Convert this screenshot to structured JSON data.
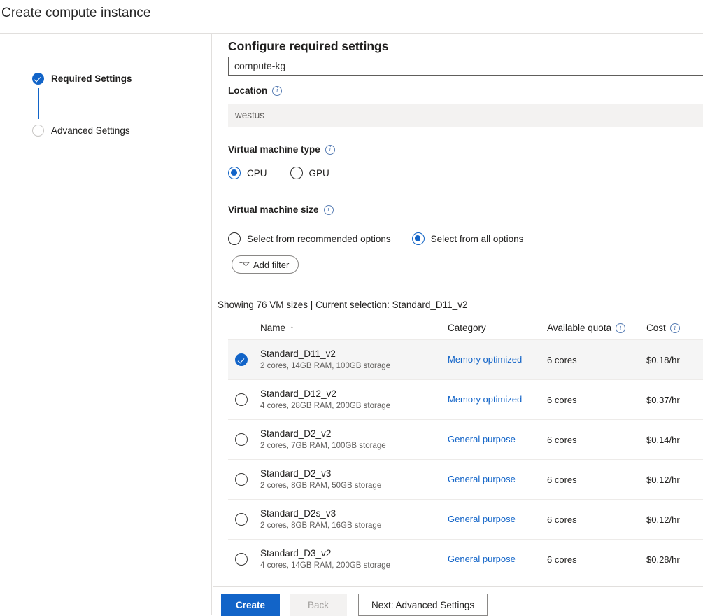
{
  "window": {
    "title": "Create compute instance"
  },
  "wizard": {
    "steps": [
      {
        "label": "Required Settings",
        "state": "done"
      },
      {
        "label": "Advanced Settings",
        "state": "todo"
      }
    ]
  },
  "panel": {
    "heading": "Configure required settings",
    "clipped_field_value": "compute-kg",
    "location": {
      "label": "Location",
      "info_icon": "info-icon",
      "value": "westus"
    },
    "vm_type": {
      "label": "Virtual machine type",
      "info_icon": "info-icon",
      "options": [
        {
          "label": "CPU",
          "selected": true
        },
        {
          "label": "GPU",
          "selected": false
        }
      ]
    },
    "vm_size": {
      "label": "Virtual machine size",
      "info_icon": "info-icon",
      "options": [
        {
          "label": "Select from recommended options",
          "selected": false
        },
        {
          "label": "Select from all options",
          "selected": true
        }
      ],
      "add_filter_label": "Add filter",
      "add_filter_icon": "filter-funnel-icon"
    },
    "showing_text": "Showing 76 VM sizes | Current selection: Standard_D11_v2"
  },
  "table": {
    "columns": {
      "name": "Name",
      "name_sort": "↑",
      "category": "Category",
      "quota": "Available quota",
      "quota_info_icon": "info-icon",
      "cost": "Cost",
      "cost_info_icon": "info-icon"
    },
    "rows": [
      {
        "name": "Standard_D11_v2",
        "spec": "2 cores, 14GB RAM, 100GB storage",
        "category": "Memory optimized",
        "quota": "6 cores",
        "cost": "$0.18/hr",
        "selected": true
      },
      {
        "name": "Standard_D12_v2",
        "spec": "4 cores, 28GB RAM, 200GB storage",
        "category": "Memory optimized",
        "quota": "6 cores",
        "cost": "$0.37/hr",
        "selected": false
      },
      {
        "name": "Standard_D2_v2",
        "spec": "2 cores, 7GB RAM, 100GB storage",
        "category": "General purpose",
        "quota": "6 cores",
        "cost": "$0.14/hr",
        "selected": false
      },
      {
        "name": "Standard_D2_v3",
        "spec": "2 cores, 8GB RAM, 50GB storage",
        "category": "General purpose",
        "quota": "6 cores",
        "cost": "$0.12/hr",
        "selected": false
      },
      {
        "name": "Standard_D2s_v3",
        "spec": "2 cores, 8GB RAM, 16GB storage",
        "category": "General purpose",
        "quota": "6 cores",
        "cost": "$0.12/hr",
        "selected": false
      },
      {
        "name": "Standard_D3_v2",
        "spec": "4 cores, 14GB RAM, 200GB storage",
        "category": "General purpose",
        "quota": "6 cores",
        "cost": "$0.28/hr",
        "selected": false
      }
    ]
  },
  "footer": {
    "create_label": "Create",
    "back_label": "Back",
    "next_label": "Next: Advanced Settings"
  },
  "colors": {
    "accent": "#1264c8",
    "link": "#1264c8",
    "selected_row_bg": "#f5f5f5",
    "readonly_bg": "#f3f2f1",
    "border": "#e1dfdd"
  }
}
